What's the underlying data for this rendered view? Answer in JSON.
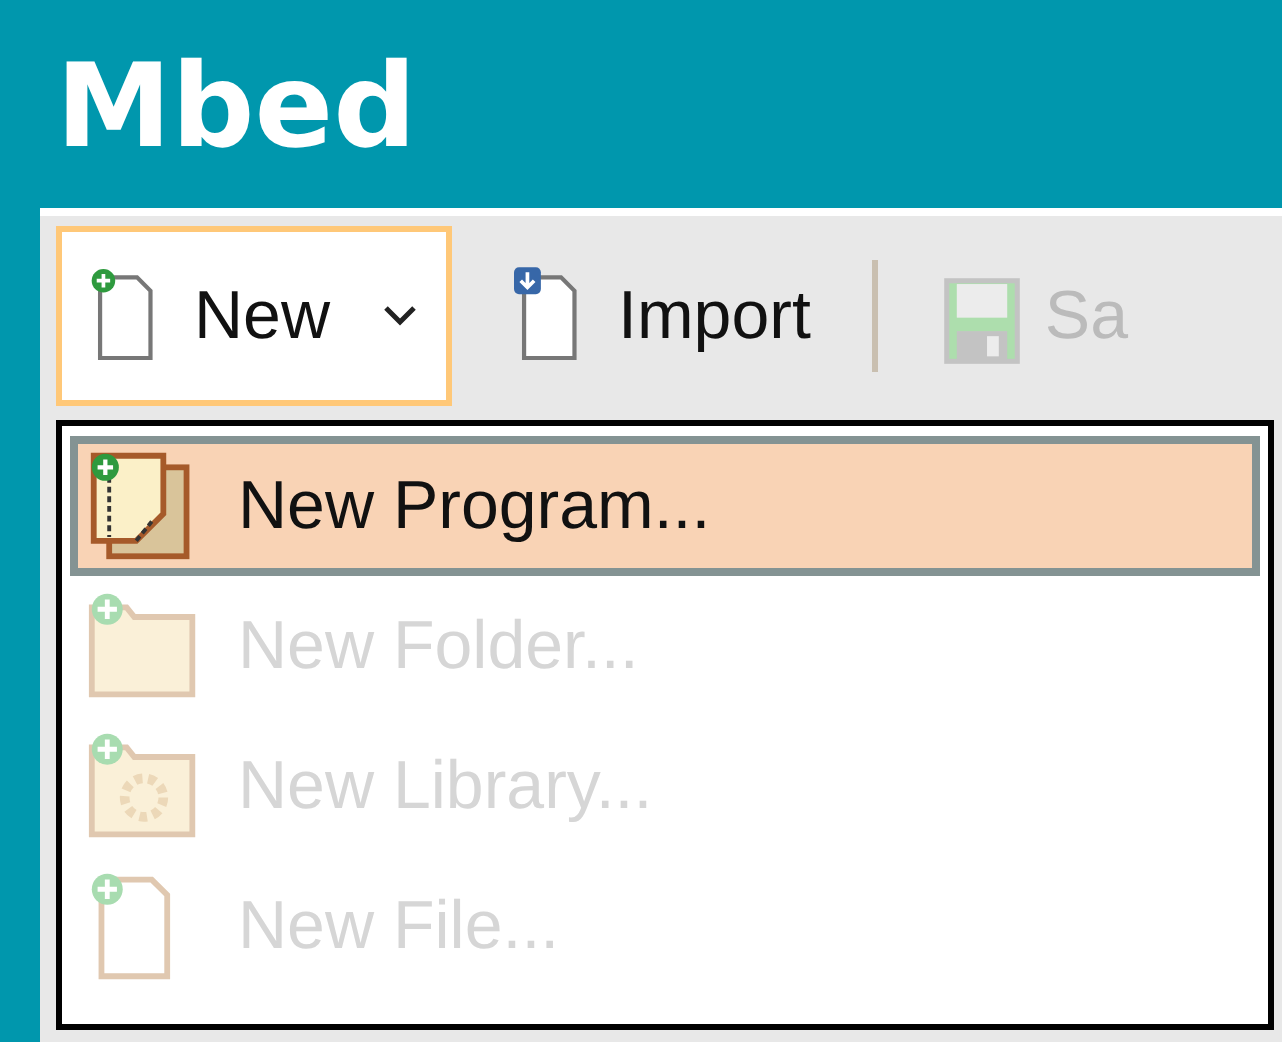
{
  "app": {
    "title": "Mbed"
  },
  "toolbar": [
    {
      "label": "New",
      "kind": "new",
      "expanded": true,
      "disabled": false
    },
    {
      "label": "Import",
      "kind": "import",
      "expanded": false,
      "disabled": false
    },
    {
      "label": "Sa",
      "kind": "save",
      "expanded": false,
      "disabled": true
    }
  ],
  "menu": {
    "items": [
      {
        "label": "New Program...",
        "kind": "program",
        "selected": true,
        "disabled": false
      },
      {
        "label": "New Folder...",
        "kind": "folder",
        "selected": false,
        "disabled": true
      },
      {
        "label": "New Library...",
        "kind": "library",
        "selected": false,
        "disabled": true
      },
      {
        "label": "New File...",
        "kind": "file",
        "selected": false,
        "disabled": true
      }
    ]
  }
}
